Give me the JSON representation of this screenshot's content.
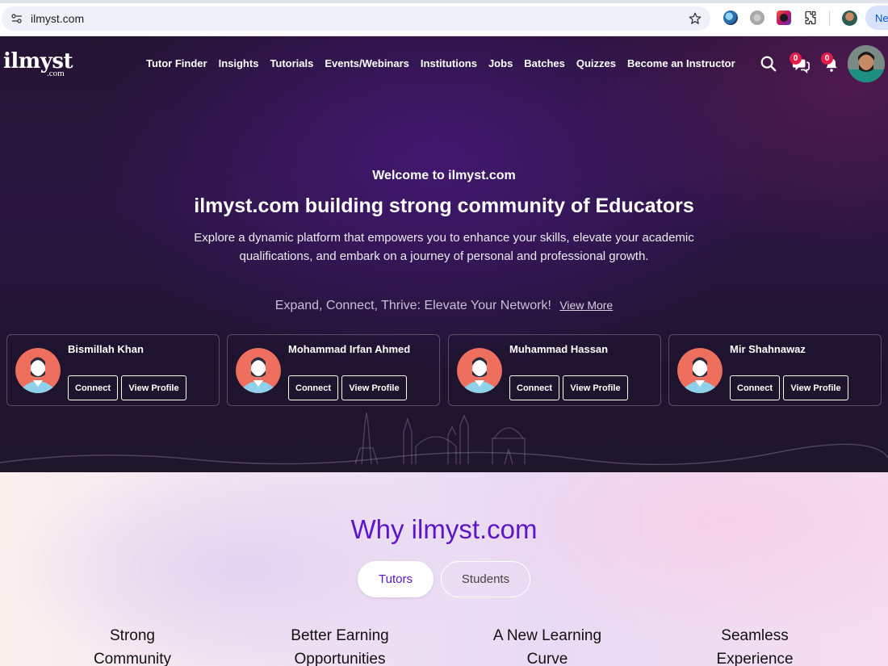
{
  "browser": {
    "url": "ilmyst.com",
    "new_chrome_label": "Ne"
  },
  "header": {
    "logo_text": "ilmyst",
    "logo_sub": ".com",
    "nav": [
      "Tutor Finder",
      "Insights",
      "Tutorials",
      "Events/Webinars",
      "Institutions",
      "Jobs",
      "Batches",
      "Quizzes",
      "Become an Instructor"
    ],
    "messages_count": "0",
    "notifications_count": "0"
  },
  "hero": {
    "kicker": "Welcome to ilmyst.com",
    "title": "ilmyst.com building strong community of Educators",
    "description": "Explore a dynamic platform that empowers you to enhance your skills, elevate your academic qualifications, and embark on a journey of personal and professional growth.",
    "network_text": "Expand, Connect, Thrive: Elevate Your Network!",
    "view_more": "View More"
  },
  "profiles": [
    {
      "name": "Bismillah Khan",
      "connect": "Connect",
      "view": "View Profile"
    },
    {
      "name": "Mohammad Irfan Ahmed",
      "connect": "Connect",
      "view": "View Profile"
    },
    {
      "name": "Muhammad Hassan",
      "connect": "Connect",
      "view": "View Profile"
    },
    {
      "name": "Mir Shahnawaz",
      "connect": "Connect",
      "view": "View Profile"
    }
  ],
  "why": {
    "title": "Why ilmyst.com",
    "tabs": [
      "Tutors",
      "Students"
    ],
    "features": [
      [
        "Strong",
        "Community"
      ],
      [
        "Better Earning",
        "Opportunities"
      ],
      [
        "A New Learning",
        "Curve"
      ],
      [
        "Seamless",
        "Experience"
      ]
    ]
  },
  "colors": {
    "accent": "#5b16c8",
    "badge": "#e11d48",
    "hero_bg": "#241432"
  }
}
